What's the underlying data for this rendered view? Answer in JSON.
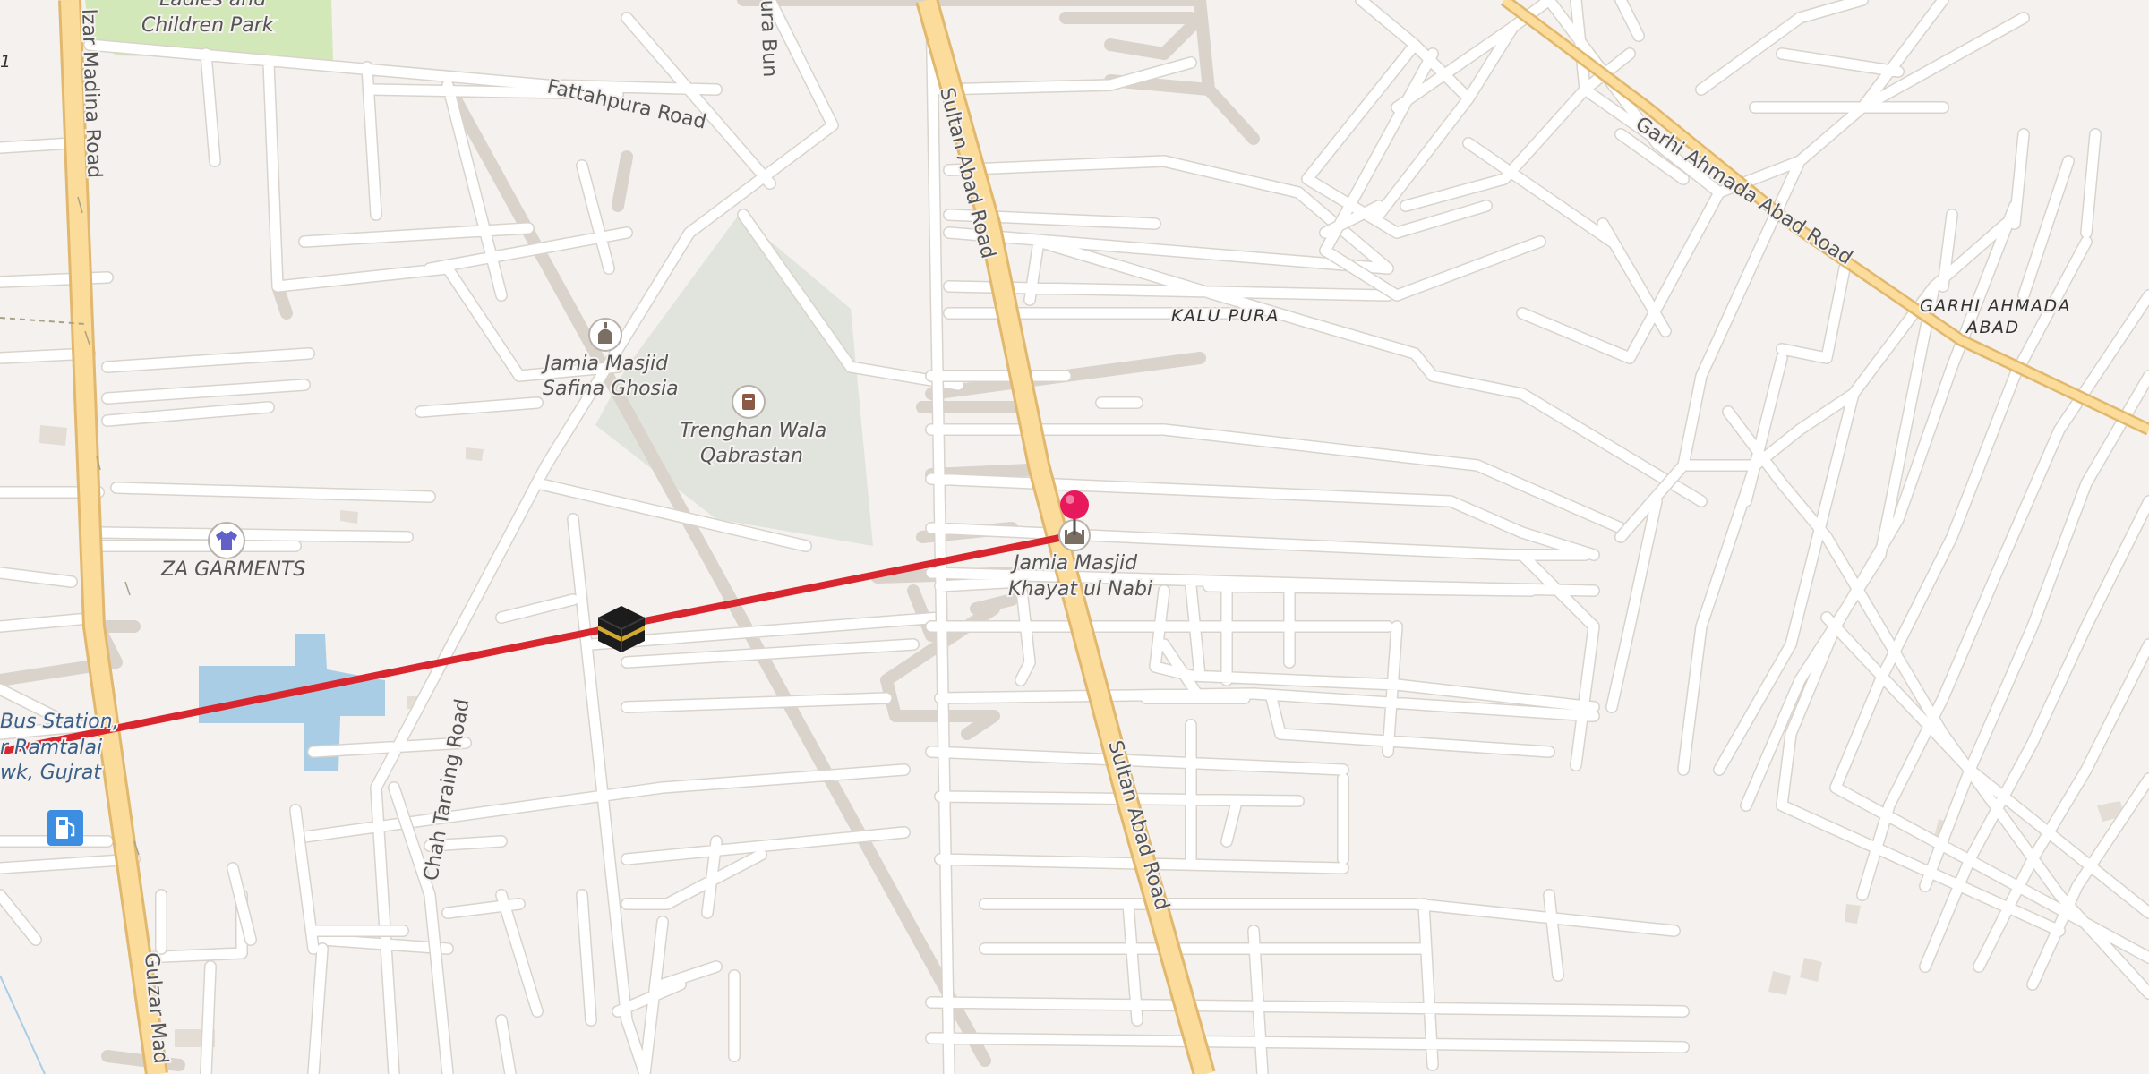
{
  "map": {
    "colors": {
      "background": "#f4f1ee",
      "street": "#ffffff",
      "main_road": "#fbdc9a",
      "main_road_casing": "#e2b86e",
      "park": "#d3e8b8",
      "cemetery": "#e1e4dc",
      "water": "#aacde6",
      "route_line": "#d9262e",
      "marker": "#e8185c"
    },
    "roads": {
      "gulzar_madina_top": "lzar Madina Road",
      "gulzar_madina_bottom": "Gulzar Mad",
      "fattahpura": "Fattahpura Road",
      "pura_bun": "ura Bun",
      "sultan_abad_top": "Sultan Abad Road",
      "sultan_abad_bottom": "Sultan Abad Road",
      "garhi_ahmada_abad": "Garhi Ahmada Abad Road",
      "chah_taraing": "Chah Taraing Road"
    },
    "places": {
      "kalu_pura": "KALU PURA",
      "garhi_ahmada_line1": "GARHI AHMADA",
      "garhi_ahmada_line2": "ABAD",
      "edge_digit": "1"
    },
    "pois": {
      "park_line1": "Ladies and",
      "park_line2": "Children Park",
      "masjid_safina_line1": "Jamia Masjid",
      "masjid_safina_line2": "Safina Ghosia",
      "qabrastan_line1": "Trenghan Wala",
      "qabrastan_line2": "Qabrastan",
      "garments": "ZA GARMENTS",
      "masjid_khayat_line1": "Jamia Masjid",
      "masjid_khayat_line2": "Khayat ul Nabi",
      "bus_line1": "Bus Station,",
      "bus_line2": "r Ramtalai",
      "bus_line3": "wk, Gujrat"
    },
    "icons": {
      "mosque": "mosque-icon",
      "cemetery": "cemetery-icon",
      "clothes": "clothes-shop-icon",
      "fuel": "fuel-station-icon",
      "kaaba": "kaaba-icon",
      "pin": "location-pin-icon"
    }
  }
}
